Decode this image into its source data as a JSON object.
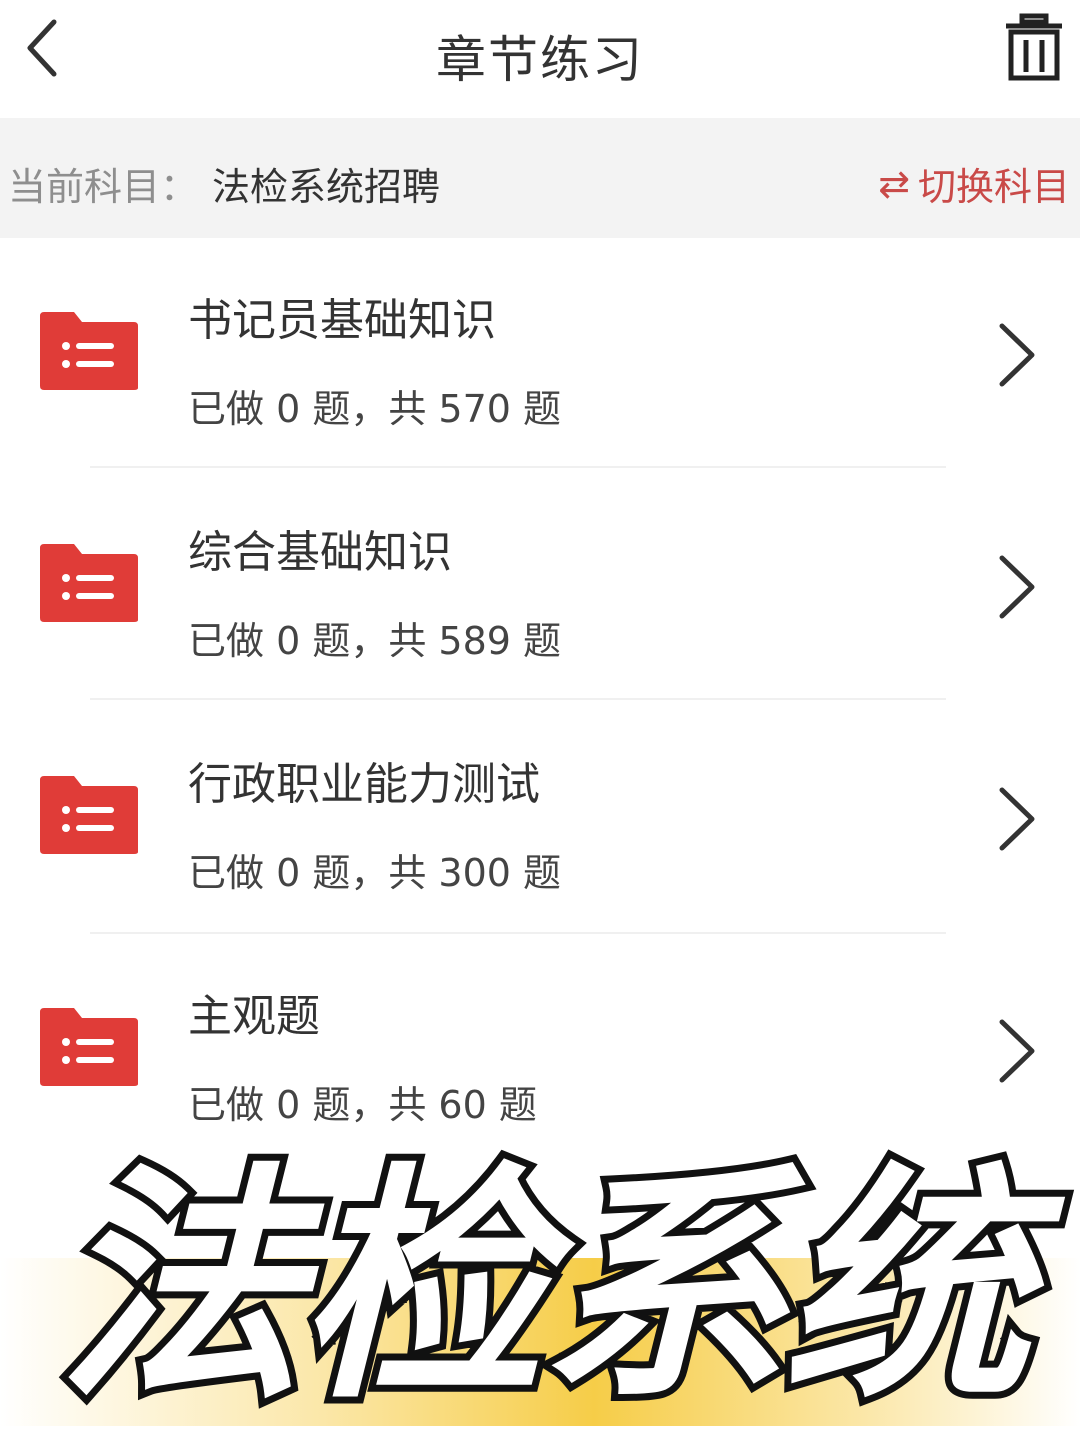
{
  "navbar": {
    "title": "章节练习"
  },
  "subject": {
    "label": "当前科目：",
    "value": "法检系统招聘",
    "switch_arrows": "⇄",
    "switch_label": "切换科目"
  },
  "chapters": [
    {
      "title": "书记员基础知识",
      "progress": "已做 0 题，共 570 题"
    },
    {
      "title": "综合基础知识",
      "progress": "已做 0 题，共 589 题"
    },
    {
      "title": "行政职业能力测试",
      "progress": "已做 0 题，共 300 题"
    },
    {
      "title": "主观题",
      "progress": "已做 0 题，共 60 题"
    }
  ],
  "banner": {
    "text": "法检系统"
  },
  "colors": {
    "accent": "#e03c38",
    "switch_text": "#c94a48",
    "subject_bar": "#f3f3f3"
  },
  "icons": {
    "back": "chevron-left-icon",
    "trash": "trash-icon",
    "folder": "folder-list-icon",
    "chevron": "chevron-right-icon"
  }
}
